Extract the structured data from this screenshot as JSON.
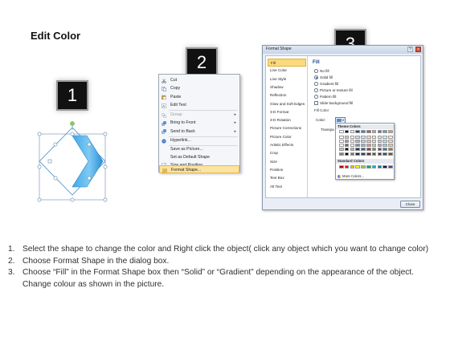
{
  "slide_title": "Edit Color",
  "steps": [
    "1",
    "2",
    "3"
  ],
  "context_menu": {
    "items": [
      {
        "label": "Cut",
        "icon": "scissors-icon",
        "enabled": true
      },
      {
        "label": "Copy",
        "icon": "copy-icon",
        "enabled": true
      },
      {
        "label": "Paste",
        "icon": "paste-icon",
        "enabled": true
      },
      {
        "label": "Edit Text",
        "icon": "edit-text-icon",
        "enabled": true
      },
      {
        "label": "Group",
        "icon": "group-icon",
        "enabled": false,
        "submenu": true
      },
      {
        "label": "Bring to Front",
        "icon": "bring-front-icon",
        "enabled": true,
        "submenu": true
      },
      {
        "label": "Send to Back",
        "icon": "send-back-icon",
        "enabled": true,
        "submenu": true
      },
      {
        "label": "Hyperlink...",
        "icon": "hyperlink-icon",
        "enabled": true
      },
      {
        "label": "Save as Picture...",
        "icon": "",
        "enabled": true
      },
      {
        "label": "Set as Default Shape",
        "icon": "",
        "enabled": true
      },
      {
        "label": "Size and Position...",
        "icon": "size-icon",
        "enabled": true
      },
      {
        "label": "Format Shape...",
        "icon": "format-shape-icon",
        "enabled": true,
        "highlighted": true
      }
    ]
  },
  "dialog": {
    "title": "Format Shape",
    "help": "?",
    "close_x": "×",
    "nav": [
      "Fill",
      "Line Color",
      "Line Style",
      "Shadow",
      "Reflection",
      "Glow and Soft Edges",
      "3-D Format",
      "3-D Rotation",
      "Picture Corrections",
      "Picture Color",
      "Artistic Effects",
      "Crop",
      "Size",
      "Position",
      "Text Box",
      "Alt Text"
    ],
    "active_nav": "Fill",
    "pane_heading": "Fill",
    "options": [
      {
        "label": "No fill",
        "selected": false
      },
      {
        "label": "Solid fill",
        "selected": true
      },
      {
        "label": "Gradient fill",
        "selected": false
      },
      {
        "label": "Picture or texture fill",
        "selected": false
      },
      {
        "label": "Pattern fill",
        "selected": false
      }
    ],
    "checkbox_label": "Slide background fill",
    "fill_color_heading": "Fill Color",
    "color_label": "Color:",
    "transparency_label": "Transpa",
    "close_button": "Close"
  },
  "color_picker": {
    "theme_heading": "Theme Colors",
    "standard_heading": "Standard Colors",
    "more_colors": "More Colors...",
    "theme_colors": [
      "#ffffff",
      "#000000",
      "#eeece1",
      "#1f497d",
      "#4f81bd",
      "#c0504d",
      "#9bbb59",
      "#8064a2",
      "#4bacc6",
      "#f79646"
    ],
    "standard_colors": [
      "#c00000",
      "#ff0000",
      "#ffc000",
      "#ffff00",
      "#92d050",
      "#00b050",
      "#00b0f0",
      "#0070c0",
      "#002060",
      "#7030a0"
    ]
  },
  "instructions": [
    {
      "num": "1.",
      "text": "Select the shape to change the color and Right click the object( click any object which you want to change color)"
    },
    {
      "num": "2.",
      "text": "Choose Format Shape in the dialog box."
    },
    {
      "num": "3.",
      "text": "Choose “Fill” in the Format Shape box then “Solid” or “Gradient” depending on the appearance of the object. Change colour as shown in the picture."
    }
  ]
}
